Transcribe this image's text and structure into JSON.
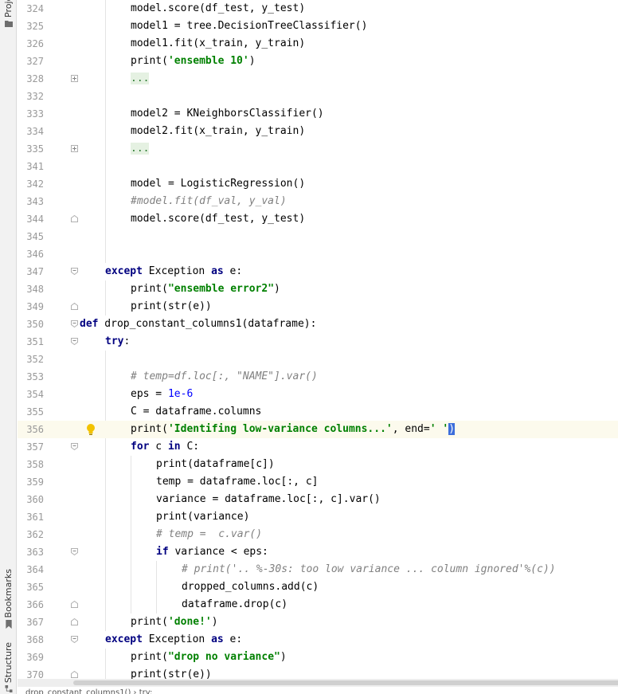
{
  "sidebar": {
    "project_label": "Project",
    "bookmarks_label": "Bookmarks",
    "structure_label": "Structure"
  },
  "breadcrumb": {
    "text": "drop_constant_columns1() › try:"
  },
  "editor": {
    "current_line": "356",
    "lines": [
      {
        "num": "324",
        "indent": 2,
        "fold": "",
        "tokens": [
          [
            "t",
            "model.score(df_test, y_test)"
          ]
        ]
      },
      {
        "num": "325",
        "indent": 2,
        "fold": "",
        "tokens": [
          [
            "t",
            "model1 = tree.DecisionTreeClassifier()"
          ]
        ]
      },
      {
        "num": "326",
        "indent": 2,
        "fold": "",
        "tokens": [
          [
            "t",
            "model1.fit(x_train, y_train)"
          ]
        ]
      },
      {
        "num": "327",
        "indent": 2,
        "fold": "",
        "tokens": [
          [
            "t",
            "print("
          ],
          [
            "s",
            "'ensemble 10'"
          ],
          [
            "t",
            ")"
          ]
        ]
      },
      {
        "num": "328",
        "indent": 2,
        "fold": "plus",
        "tokens": [
          [
            "f",
            "..."
          ]
        ]
      },
      {
        "num": "332",
        "indent": 2,
        "fold": "",
        "tokens": []
      },
      {
        "num": "333",
        "indent": 2,
        "fold": "",
        "tokens": [
          [
            "t",
            "model2 = KNeighborsClassifier()"
          ]
        ]
      },
      {
        "num": "334",
        "indent": 2,
        "fold": "",
        "tokens": [
          [
            "t",
            "model2.fit(x_train, y_train)"
          ]
        ]
      },
      {
        "num": "335",
        "indent": 2,
        "fold": "plus",
        "tokens": [
          [
            "f",
            "..."
          ]
        ]
      },
      {
        "num": "341",
        "indent": 2,
        "fold": "",
        "tokens": []
      },
      {
        "num": "342",
        "indent": 2,
        "fold": "",
        "tokens": [
          [
            "t",
            "model = LogisticRegression()"
          ]
        ]
      },
      {
        "num": "343",
        "indent": 2,
        "fold": "",
        "tokens": [
          [
            "c",
            "#model.fit(df_val, y_val)"
          ]
        ]
      },
      {
        "num": "344",
        "indent": 2,
        "fold": "end",
        "tokens": [
          [
            "t",
            "model.score(df_test, y_test)"
          ]
        ]
      },
      {
        "num": "345",
        "indent": 0,
        "fold": "",
        "tokens": []
      },
      {
        "num": "346",
        "indent": 0,
        "fold": "",
        "tokens": []
      },
      {
        "num": "347",
        "indent": 1,
        "fold": "start",
        "tokens": [
          [
            "k",
            "except"
          ],
          [
            "t",
            " Exception "
          ],
          [
            "k",
            "as"
          ],
          [
            "t",
            " e:"
          ]
        ]
      },
      {
        "num": "348",
        "indent": 2,
        "fold": "",
        "tokens": [
          [
            "t",
            "print("
          ],
          [
            "s",
            "\"ensemble error2\""
          ],
          [
            "t",
            ")"
          ]
        ]
      },
      {
        "num": "349",
        "indent": 2,
        "fold": "end",
        "tokens": [
          [
            "t",
            "print(str(e))"
          ]
        ]
      },
      {
        "num": "350",
        "indent": 0,
        "fold": "start",
        "tokens": [
          [
            "k",
            "def"
          ],
          [
            "t",
            " drop_constant_columns1(dataframe):"
          ]
        ]
      },
      {
        "num": "351",
        "indent": 1,
        "fold": "start",
        "tokens": [
          [
            "k",
            "try"
          ],
          [
            "t",
            ":"
          ]
        ]
      },
      {
        "num": "352",
        "indent": 2,
        "fold": "",
        "tokens": []
      },
      {
        "num": "353",
        "indent": 2,
        "fold": "",
        "tokens": [
          [
            "c",
            "# temp=df.loc[:, \"NAME\"].var()"
          ]
        ]
      },
      {
        "num": "354",
        "indent": 2,
        "fold": "",
        "tokens": [
          [
            "t",
            "eps = "
          ],
          [
            "n",
            "1e-6"
          ]
        ]
      },
      {
        "num": "355",
        "indent": 2,
        "fold": "",
        "tokens": [
          [
            "t",
            "C = dataframe.columns"
          ]
        ]
      },
      {
        "num": "356",
        "indent": 2,
        "fold": "",
        "bulb": true,
        "tokens": [
          [
            "t",
            "print("
          ],
          [
            "s",
            "'Identifing low-variance columns...'"
          ],
          [
            "t",
            ", end="
          ],
          [
            "s",
            "' '"
          ],
          [
            "x",
            ")"
          ]
        ]
      },
      {
        "num": "357",
        "indent": 2,
        "fold": "start",
        "tokens": [
          [
            "k",
            "for"
          ],
          [
            "t",
            " c "
          ],
          [
            "k",
            "in"
          ],
          [
            "t",
            " C:"
          ]
        ]
      },
      {
        "num": "358",
        "indent": 3,
        "fold": "",
        "tokens": [
          [
            "t",
            "print(dataframe[c])"
          ]
        ]
      },
      {
        "num": "359",
        "indent": 3,
        "fold": "",
        "tokens": [
          [
            "t",
            "temp = dataframe.loc[:, c]"
          ]
        ]
      },
      {
        "num": "360",
        "indent": 3,
        "fold": "",
        "tokens": [
          [
            "t",
            "variance = dataframe.loc[:, c].var()"
          ]
        ]
      },
      {
        "num": "361",
        "indent": 3,
        "fold": "",
        "tokens": [
          [
            "t",
            "print(variance)"
          ]
        ]
      },
      {
        "num": "362",
        "indent": 3,
        "fold": "",
        "tokens": [
          [
            "c",
            "# temp =  c.var()"
          ]
        ]
      },
      {
        "num": "363",
        "indent": 3,
        "fold": "start",
        "tokens": [
          [
            "k",
            "if"
          ],
          [
            "t",
            " variance < eps:"
          ]
        ]
      },
      {
        "num": "364",
        "indent": 4,
        "fold": "",
        "tokens": [
          [
            "c",
            "# print('.. %-30s: too low variance ... column ignored'%(c))"
          ]
        ]
      },
      {
        "num": "365",
        "indent": 4,
        "fold": "",
        "tokens": [
          [
            "t",
            "dropped_columns.add(c)"
          ]
        ]
      },
      {
        "num": "366",
        "indent": 4,
        "fold": "end",
        "tokens": [
          [
            "t",
            "dataframe.drop(c)"
          ]
        ]
      },
      {
        "num": "367",
        "indent": 2,
        "fold": "end",
        "tokens": [
          [
            "t",
            "print("
          ],
          [
            "s",
            "'done!'"
          ],
          [
            "t",
            ")"
          ]
        ]
      },
      {
        "num": "368",
        "indent": 1,
        "fold": "start",
        "tokens": [
          [
            "k",
            "except"
          ],
          [
            "t",
            " Exception "
          ],
          [
            "k",
            "as"
          ],
          [
            "t",
            " e:"
          ]
        ]
      },
      {
        "num": "369",
        "indent": 2,
        "fold": "",
        "tokens": [
          [
            "t",
            "print("
          ],
          [
            "s",
            "\"drop no variance\""
          ],
          [
            "t",
            ")"
          ]
        ]
      },
      {
        "num": "370",
        "indent": 2,
        "fold": "end",
        "tokens": [
          [
            "t",
            "print(str(e))"
          ]
        ]
      }
    ]
  }
}
